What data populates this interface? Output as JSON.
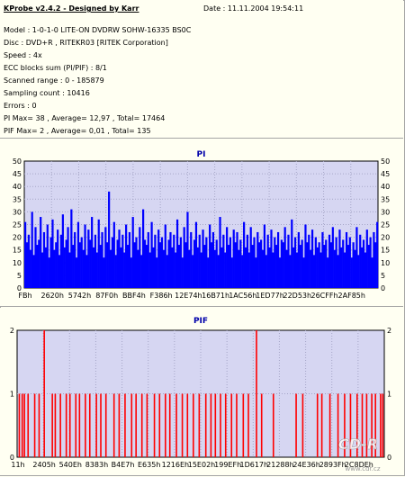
{
  "header": {
    "app_title": "KProbe v2.4.2 - Designed by Karr",
    "date": "Date : 11.11.2004 19:54:11"
  },
  "info_lines": [
    "Model : 1-0-1-0 LITE-ON DVDRW SOHW-16335 BS0C",
    "Disc : DVD+R , RITEKR03 [RITEK Corporation]",
    "Speed : 4x",
    "ECC blocks sum (PI/PIF) : 8/1",
    "Scanned range : 0 - 185879",
    "Sampling count : 10416",
    "Errors : 0",
    "PI Max= 38 , Average= 12,97 , Total= 17464",
    "PIF Max= 2 , Average= 0,01 , Total= 135"
  ],
  "colors": {
    "background": "#fffff2",
    "plot_background": "#d6d6f2",
    "pi_bars": "#0000ff",
    "pif_bars": "#ff0000",
    "title": "#0000aa",
    "grid": "#a6a6c8",
    "border": "#a5a5a5"
  },
  "watermark": {
    "logo": "CD-R",
    "url": "www.cdr.cz"
  },
  "chart_data": [
    {
      "type": "bar",
      "title": "PI",
      "xlabel": "",
      "ylabel": "",
      "ylim": [
        0,
        50
      ],
      "y_ticks": [
        0,
        5,
        10,
        15,
        20,
        25,
        30,
        35,
        40,
        45,
        50
      ],
      "x_tick_labels": [
        "FBh",
        "2620h",
        "5742h",
        "87F0h",
        "BBF4h",
        "F386h",
        "12E74h",
        "16B71h",
        "1AC56h",
        "1ED77h",
        "22D53h",
        "26CFFh",
        "2AF85h"
      ],
      "grid": true,
      "summary": {
        "max": 38,
        "average": 12.97,
        "total": 17464
      },
      "values": [
        26,
        18,
        21,
        15,
        30,
        13,
        24,
        17,
        19,
        28,
        14,
        22,
        16,
        25,
        12,
        20,
        27,
        15,
        18,
        23,
        13,
        21,
        29,
        16,
        19,
        24,
        14,
        31,
        17,
        22,
        12,
        26,
        18,
        20,
        15,
        25,
        13,
        23,
        19,
        28,
        16,
        21,
        14,
        27,
        17,
        22,
        12,
        24,
        18,
        38,
        15,
        20,
        26,
        13,
        19,
        23,
        16,
        21,
        14,
        25,
        17,
        22,
        12,
        28,
        18,
        20,
        15,
        24,
        13,
        31,
        19,
        17,
        22,
        14,
        26,
        16,
        21,
        12,
        23,
        18,
        20,
        15,
        25,
        13,
        19,
        22,
        16,
        21,
        14,
        27,
        17,
        20,
        12,
        24,
        18,
        30,
        15,
        22,
        13,
        19,
        26,
        16,
        21,
        14,
        23,
        17,
        20,
        12,
        25,
        18,
        22,
        15,
        19,
        13,
        28,
        16,
        21,
        14,
        24,
        17,
        20,
        12,
        23,
        18,
        22,
        15,
        19,
        13,
        26,
        16,
        21,
        14,
        24,
        17,
        20,
        12,
        22,
        18,
        19,
        15,
        25,
        13,
        21,
        16,
        23,
        14,
        20,
        17,
        22,
        12,
        19,
        18,
        24,
        15,
        21,
        13,
        27,
        16,
        20,
        14,
        22,
        17,
        19,
        12,
        25,
        18,
        21,
        15,
        23,
        13,
        20,
        16,
        18,
        14,
        22,
        17,
        19,
        12,
        21,
        18,
        24,
        15,
        20,
        13,
        23,
        16,
        19,
        14,
        22,
        17,
        20,
        12,
        18,
        15,
        24,
        13,
        21,
        16,
        19,
        14,
        23,
        17,
        20,
        12,
        22,
        18,
        26
      ],
      "series": [
        {
          "name": "PI",
          "color": "#0000ff"
        }
      ]
    },
    {
      "type": "bar",
      "title": "PIF",
      "xlabel": "",
      "ylabel": "",
      "ylim": [
        0,
        2
      ],
      "y_ticks": [
        0,
        1,
        2
      ],
      "x_tick_labels": [
        "11h",
        "2405h",
        "540Eh",
        "8383h",
        "B4E7h",
        "E635h",
        "1216Eh",
        "15E02h",
        "199EFh",
        "1D617h",
        "21288h",
        "24E36h",
        "2893Fh",
        "2C8DEh"
      ],
      "grid": true,
      "summary": {
        "max": 2,
        "average": 0.01,
        "total": 135
      },
      "positions": [
        0.004,
        0.012,
        0.018,
        0.028,
        0.046,
        0.058,
        0.072,
        0.094,
        0.102,
        0.116,
        0.132,
        0.142,
        0.158,
        0.168,
        0.184,
        0.196,
        0.214,
        0.226,
        0.24,
        0.262,
        0.276,
        0.292,
        0.31,
        0.322,
        0.338,
        0.352,
        0.372,
        0.386,
        0.402,
        0.414,
        0.432,
        0.448,
        0.462,
        0.478,
        0.494,
        0.512,
        0.526,
        0.538,
        0.552,
        0.566,
        0.582,
        0.596,
        0.614,
        0.628,
        0.65,
        0.664,
        0.696,
        0.758,
        0.776,
        0.816,
        0.828,
        0.85,
        0.872,
        0.89,
        0.906,
        0.924,
        0.938,
        0.95,
        0.964,
        0.974,
        0.988,
        0.994
      ],
      "values": [
        1,
        1,
        1,
        1,
        1,
        1,
        2,
        1,
        1,
        1,
        1,
        1,
        1,
        1,
        1,
        1,
        1,
        1,
        1,
        1,
        1,
        1,
        1,
        1,
        1,
        1,
        1,
        1,
        1,
        1,
        1,
        1,
        1,
        1,
        1,
        1,
        1,
        1,
        1,
        1,
        1,
        1,
        1,
        1,
        2,
        1,
        1,
        1,
        1,
        1,
        1,
        1,
        1,
        1,
        1,
        1,
        1,
        1,
        1,
        1,
        1,
        1
      ],
      "series": [
        {
          "name": "PIF",
          "color": "#ff0000"
        }
      ]
    }
  ]
}
